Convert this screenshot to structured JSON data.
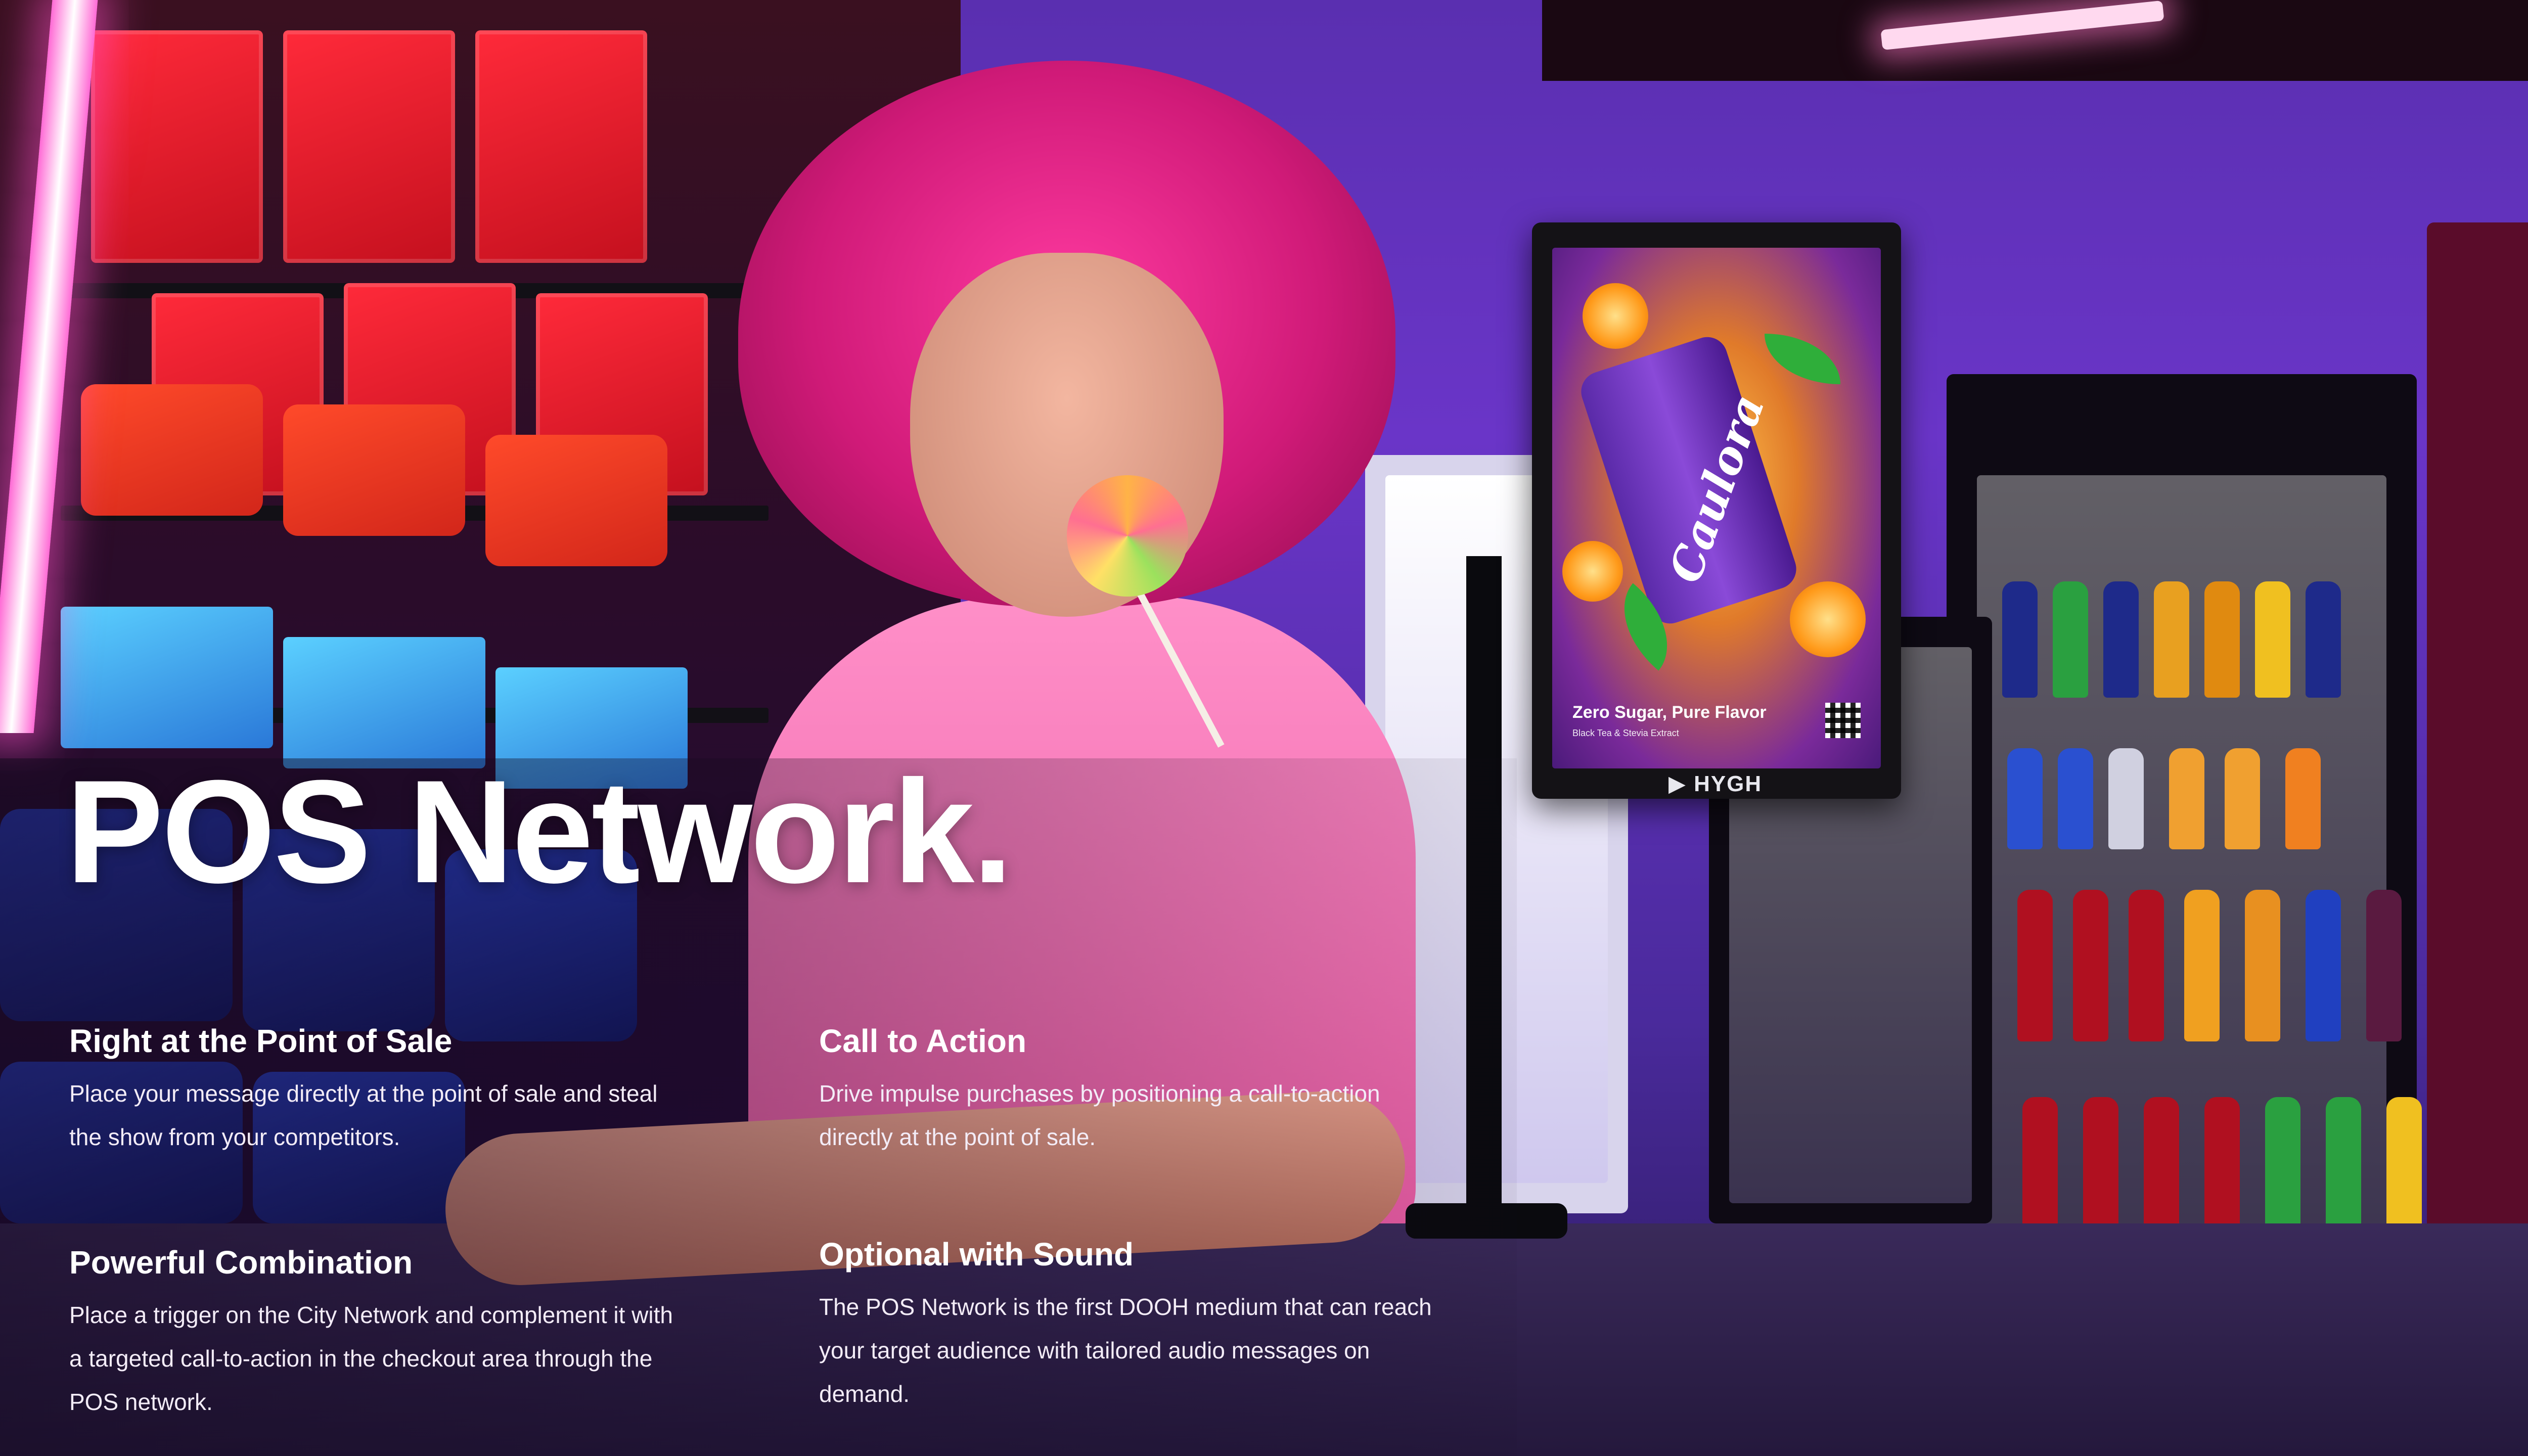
{
  "headline": "POS Network.",
  "features": [
    {
      "title": "Right at the Point of Sale",
      "body": "Place your message directly at the point of sale and steal the show from your competitors."
    },
    {
      "title": "Call to Action",
      "body": "Drive impulse purchases by positioning a call-to-action directly at the point of sale."
    },
    {
      "title": "Powerful Combination",
      "body": "Place a trigger on the City Network and complement it with a targeted call-to-action in the checkout area through the POS network."
    },
    {
      "title": "Optional with Sound",
      "body": "The POS Network is the first DOOH medium that can reach your target audience with tailored audio messages on demand."
    }
  ],
  "display": {
    "ad_brand": "Caulora",
    "ad_tagline": "Zero Sugar, Pure Flavor",
    "ad_subline": "Black Tea & Stevia Extract",
    "device_brand": "HYGH"
  },
  "colors": {
    "text": "#ffffff",
    "hat_pink": "#e0248a",
    "wall_purple": "#6a35c8"
  }
}
